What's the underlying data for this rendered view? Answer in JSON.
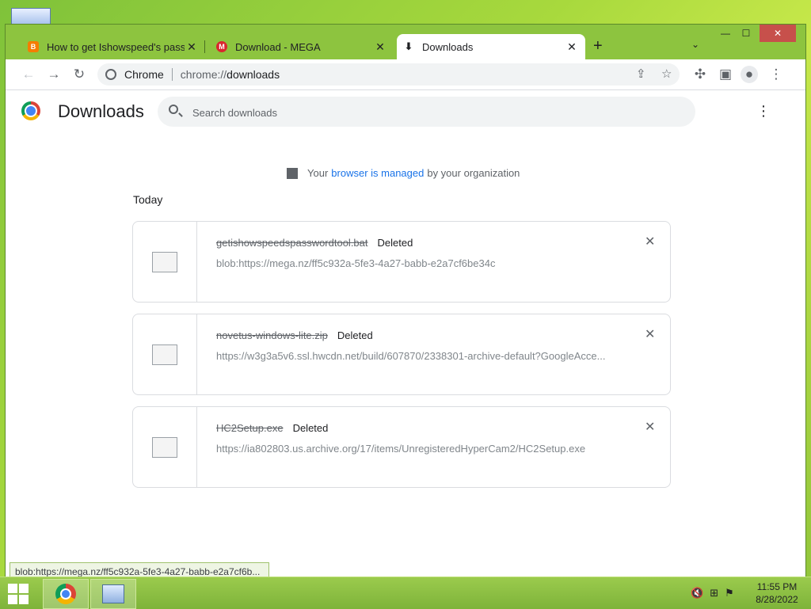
{
  "tabs": [
    {
      "title": "How to get Ishowspeed's passwo",
      "favicon": "blogger-icon",
      "color": "#f57d00"
    },
    {
      "title": "Download - MEGA",
      "favicon": "mega-icon",
      "color": "#d9272e"
    },
    {
      "title": "Downloads",
      "favicon": "download-icon"
    }
  ],
  "omnibox": {
    "site_label": "Chrome",
    "url_scheme": "chrome://",
    "url_host": "downloads"
  },
  "page": {
    "title": "Downloads",
    "search_placeholder": "Search downloads",
    "managed_prefix": "Your",
    "managed_link": "browser is managed",
    "managed_suffix": "by your organization",
    "date_group": "Today"
  },
  "downloads": [
    {
      "filename": "getishowspeedspasswordtool.bat",
      "status": "Deleted",
      "url": "blob:https://mega.nz/ff5c932a-5fe3-4a27-babb-e2a7cf6be34c"
    },
    {
      "filename": "novetus-windows-lite.zip",
      "status": "Deleted",
      "url": "https://w3g3a5v6.ssl.hwcdn.net/build/607870/2338301-archive-default?GoogleAcce..."
    },
    {
      "filename": "HC2Setup.exe",
      "status": "Deleted",
      "url": "https://ia802803.us.archive.org/17/items/UnregisteredHyperCam2/HC2Setup.exe"
    }
  ],
  "status_bubble": "blob:https://mega.nz/ff5c932a-5fe3-4a27-babb-e2a7cf6b...",
  "taskbar": {
    "time": "11:55 PM",
    "date": "8/28/2022"
  }
}
